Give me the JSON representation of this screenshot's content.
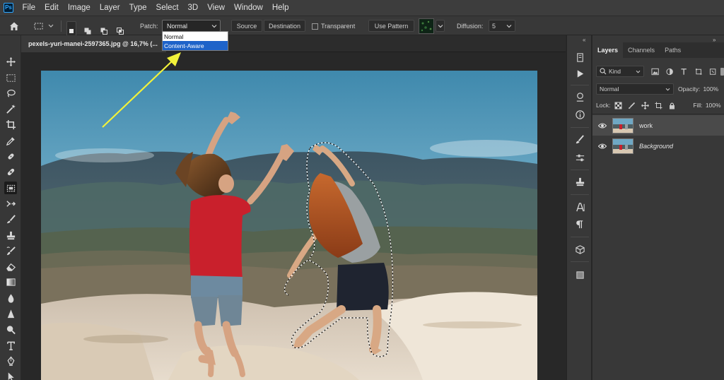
{
  "app": {
    "logo": "Ps"
  },
  "menubar": {
    "items": [
      "File",
      "Edit",
      "Image",
      "Layer",
      "Type",
      "Select",
      "3D",
      "View",
      "Window",
      "Help"
    ]
  },
  "options": {
    "patch_label": "Patch:",
    "patch_value": "Normal",
    "patch_options": [
      "Normal",
      "Content-Aware"
    ],
    "patch_selected": "Content-Aware",
    "source_label": "Source",
    "destination_label": "Destination",
    "transparent_label": "Transparent",
    "use_pattern_label": "Use Pattern",
    "diffusion_label": "Diffusion:",
    "diffusion_value": "5"
  },
  "document": {
    "tab_title": "pexels-yuri-manei-2597365.jpg @ 16,7% (..."
  },
  "toolbar": {
    "tools": [
      "move-tool",
      "marquee-tool",
      "lasso-tool",
      "magic-wand-tool",
      "crop-tool",
      "eyedropper-tool",
      "spot-healing-tool",
      "bandage-tool",
      "patch-tool",
      "content-aware-move-tool",
      "brush-tool",
      "clone-stamp-tool",
      "history-brush-tool",
      "eraser-tool",
      "gradient-tool",
      "blur-tool",
      "dodge-tool",
      "burn-tool",
      "type-tool",
      "pen-tool",
      "path-selection-tool"
    ]
  },
  "layers_panel": {
    "tabs": [
      "Layers",
      "Channels",
      "Paths"
    ],
    "active_tab": "Layers",
    "filter_label": "Kind",
    "blend_mode": "Normal",
    "opacity_label": "Opacity:",
    "opacity_value": "100%",
    "lock_label": "Lock:",
    "fill_label": "Fill:",
    "fill_value": "100%",
    "layers": [
      {
        "name": "work",
        "selected": true
      },
      {
        "name": "Background",
        "selected": false
      }
    ]
  },
  "colors": {
    "accent": "#1e63c9",
    "arrow": "#f2f23a",
    "menubar": "#3d3d3d",
    "panel": "#383838"
  }
}
